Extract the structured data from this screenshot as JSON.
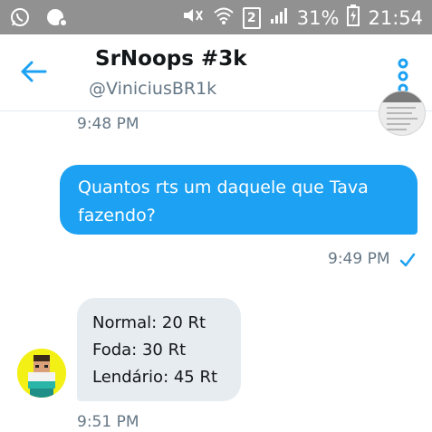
{
  "status_bar": {
    "left_icons": [
      "whatsapp-icon",
      "messenger-icon"
    ],
    "right_icons": [
      "mute-icon",
      "wifi-icon",
      "sim-icon",
      "signal-icon",
      "battery-charging-icon"
    ],
    "sim_slot": "2",
    "battery": "31%",
    "time": "21:54",
    "color": "#919191"
  },
  "header": {
    "title": "SrNoops #3k",
    "handle": "@ViniciusBR1k",
    "back_icon": "arrow-left-icon",
    "menu_icon": "overflow-menu-icon",
    "accent": "#1da1f2"
  },
  "messages": [
    {
      "time": "9:48 PM"
    },
    {
      "direction": "sent",
      "lines": [
        "Quantos rts um daquele que Tava",
        "fazendo?"
      ],
      "time": "9:49 PM",
      "status_icon": "check-icon",
      "color": "#1da1f2"
    },
    {
      "direction": "received",
      "lines": [
        "Normal: 20 Rt",
        "Foda: 30 Rt",
        "Lendário: 45 Rt"
      ],
      "time": "9:51 PM",
      "color": "#e6ecf0"
    }
  ]
}
